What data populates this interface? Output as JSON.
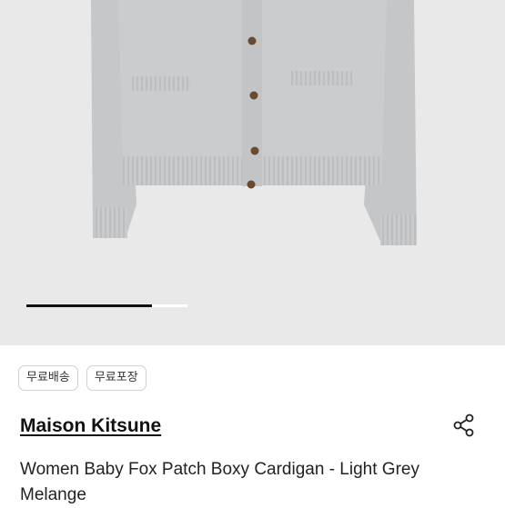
{
  "gallery": {
    "image_name": "light-grey-cardigan-photo",
    "progress": 0.78,
    "colors": {
      "background": "#e9e9ea",
      "knit": "#c7c8c9",
      "buttons": "#6b4a33",
      "progress": "#111111"
    }
  },
  "tags": [
    {
      "label": "무료배송"
    },
    {
      "label": "무료포장"
    }
  ],
  "product": {
    "brand": "Maison Kitsune",
    "title": "Women Baby Fox Patch Boxy Cardigan - Light Grey Melange"
  },
  "actions": {
    "share_icon": "share-icon"
  }
}
